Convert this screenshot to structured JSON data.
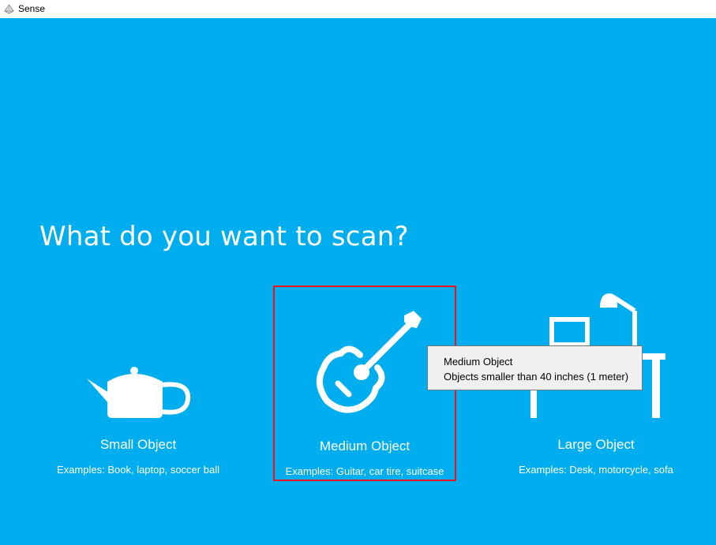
{
  "window": {
    "title": "Sense",
    "icon": "sense-logo-icon"
  },
  "heading": "What do you want to scan?",
  "options": [
    {
      "name": "Small Object",
      "examples": "Examples: Book, laptop, soccer ball",
      "icon": "teapot-icon"
    },
    {
      "name": "Medium Object",
      "examples": "Examples: Guitar, car tire, suitcase",
      "icon": "guitar-icon"
    },
    {
      "name": "Large Object",
      "examples": "Examples: Desk, motorcycle, sofa",
      "icon": "desk-lamp-icon"
    }
  ],
  "tooltip": {
    "title": "Medium Object",
    "description": "Objects smaller than 40 inches (1 meter)"
  },
  "colors": {
    "background": "#00adef",
    "highlight_border": "#e8141e",
    "foreground": "#ffffff"
  }
}
